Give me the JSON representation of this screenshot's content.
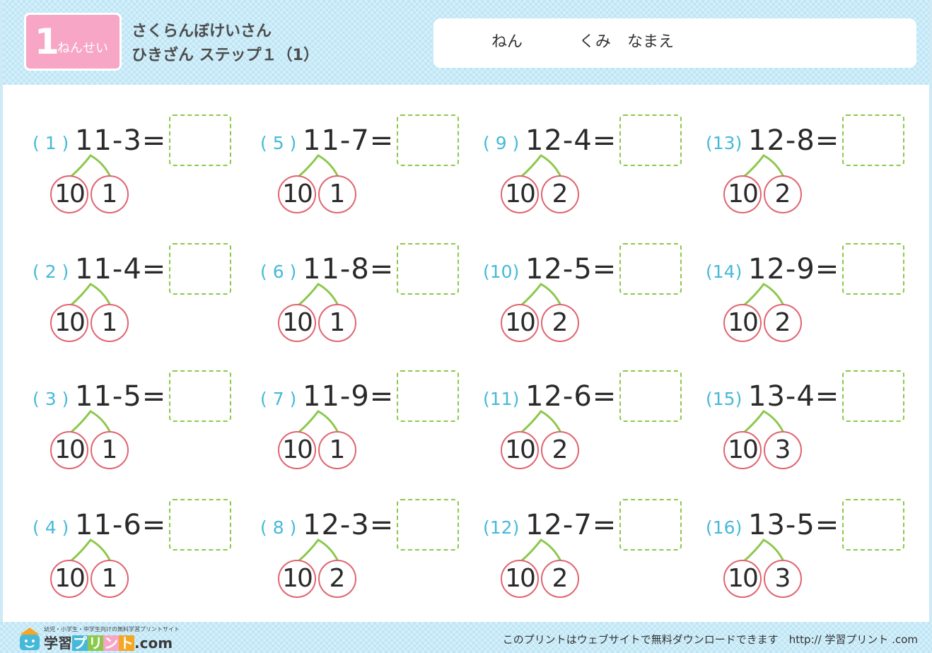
{
  "header": {
    "grade_number": "1",
    "grade_label": "ねんせい",
    "title_line1": "さくらんぼけいさん",
    "title_line2": "ひきざん ステップ１（1）",
    "name_fields": [
      "ねん",
      "くみ",
      "なまえ"
    ]
  },
  "problems": [
    {
      "num": "( 1 )",
      "expr": "11-3=",
      "left": "10",
      "right": "1"
    },
    {
      "num": "( 2 )",
      "expr": "11-4=",
      "left": "10",
      "right": "1"
    },
    {
      "num": "( 3 )",
      "expr": "11-5=",
      "left": "10",
      "right": "1"
    },
    {
      "num": "( 4 )",
      "expr": "11-6=",
      "left": "10",
      "right": "1"
    },
    {
      "num": "( 5 )",
      "expr": "11-7=",
      "left": "10",
      "right": "1"
    },
    {
      "num": "( 6 )",
      "expr": "11-8=",
      "left": "10",
      "right": "1"
    },
    {
      "num": "( 7 )",
      "expr": "11-9=",
      "left": "10",
      "right": "1"
    },
    {
      "num": "( 8 )",
      "expr": "12-3=",
      "left": "10",
      "right": "2"
    },
    {
      "num": "( 9 )",
      "expr": "12-4=",
      "left": "10",
      "right": "2"
    },
    {
      "num": "(10)",
      "expr": "12-5=",
      "left": "10",
      "right": "2"
    },
    {
      "num": "(11)",
      "expr": "12-6=",
      "left": "10",
      "right": "2"
    },
    {
      "num": "(12)",
      "expr": "12-7=",
      "left": "10",
      "right": "2"
    },
    {
      "num": "(13)",
      "expr": "12-8=",
      "left": "10",
      "right": "2"
    },
    {
      "num": "(14)",
      "expr": "12-9=",
      "left": "10",
      "right": "2"
    },
    {
      "num": "(15)",
      "expr": "13-4=",
      "left": "10",
      "right": "3"
    },
    {
      "num": "(16)",
      "expr": "13-5=",
      "left": "10",
      "right": "3"
    }
  ],
  "footer": {
    "logo_tagline": "幼児・小学生・中学生向けの無料学習プリントサイト",
    "logo_text_1": "学習",
    "logo_text_kana": [
      "プ",
      "リ",
      "ン",
      "ト"
    ],
    "logo_text_2": ".com",
    "note": "このプリントはウェブサイトで無料ダウンロードできます　http:// 学習プリント .com"
  },
  "colors": {
    "header_bg": "#bfe6f6",
    "badge": "#f7a6c6",
    "problem_number": "#46b9d9",
    "answer_box": "#8cc84b",
    "cherry_stem": "#8cc84b",
    "cherry_circle": "#e06470",
    "logo_kana": [
      "#46b9d9",
      "#8cc84b",
      "#f7a6c6",
      "#f5a623"
    ]
  }
}
